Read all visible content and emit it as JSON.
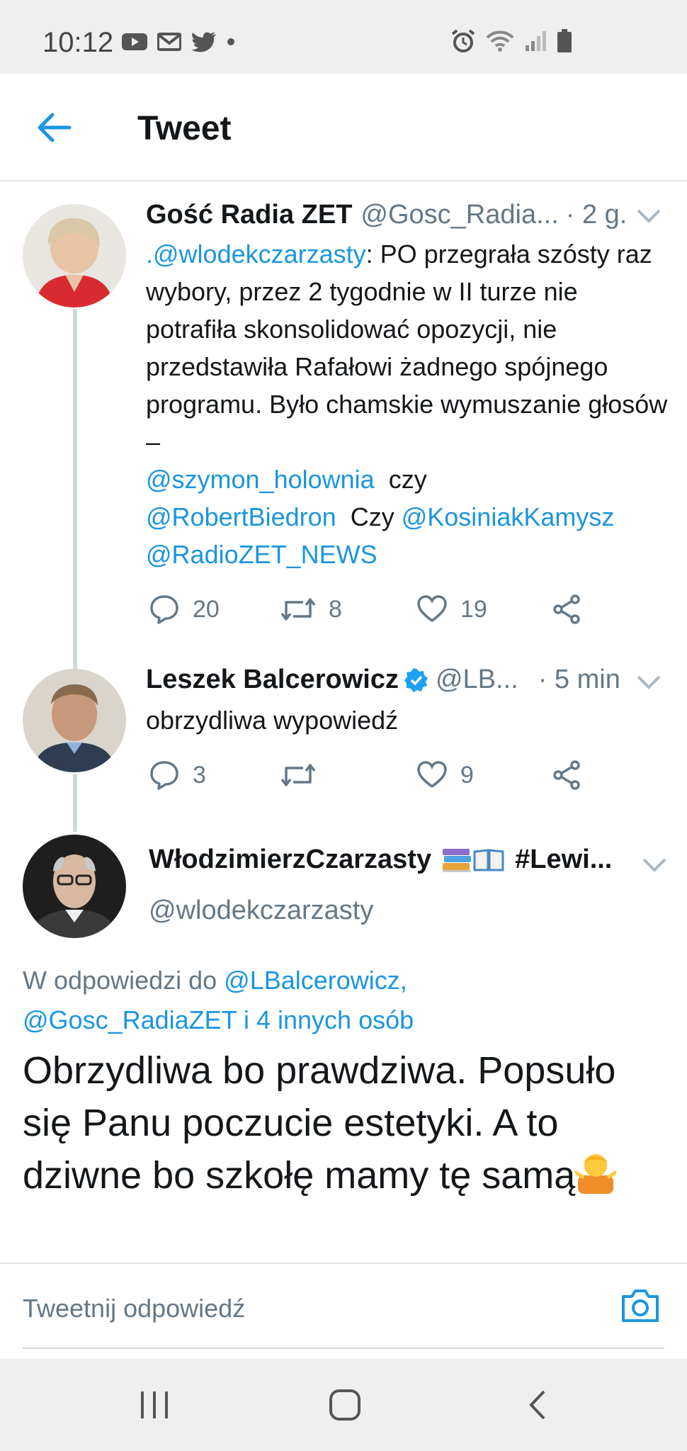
{
  "status_bar": {
    "time": "10:12",
    "left_icons": [
      "youtube-icon",
      "gmail-icon",
      "twitter-icon",
      "dot-icon"
    ],
    "right_icons": [
      "alarm-icon",
      "wifi-icon",
      "signal-icon",
      "battery-icon"
    ]
  },
  "header": {
    "title": "Tweet"
  },
  "tweets": [
    {
      "name": "Gość Radia ZET",
      "handle": "@Gosc_Radia...",
      "time": "· 2 g.",
      "text": {
        "mention1": ".@wlodekczarzasty",
        "body": ": PO przegrała szósty raz wybory, przez 2 tygodnie w II turze nie potrafiła skonsolidować opozycji, nie przedstawiła Rafałowi żadnego spójnego programu. Było chamskie wymuszanie głosów –",
        "mention2": "@szymon_holownia",
        "sep1": " czy",
        "mention3": "@RobertBiedron",
        "sep2": " Czy ",
        "mention4": "@KosiniakKamysz",
        "mention5": "@RadioZET_NEWS"
      },
      "replies": "20",
      "retweets": "8",
      "likes": "19"
    },
    {
      "name": "Leszek Balcerowicz",
      "handle": "@LB...",
      "time": "· 5 min",
      "text": "obrzydliwa wypowiedź",
      "replies": "3",
      "retweets": "",
      "likes": "9"
    }
  ],
  "main_tweet": {
    "name": "WłodzimierzCzarzasty",
    "name_suffix": "#Lewi...",
    "handle": "@wlodekczarzasty",
    "reply_prefix": "W odpowiedzi do",
    "reply_to_1": "@LBalcerowicz,",
    "reply_to_2": "@Gosc_RadiaZET i 4 innych osób",
    "text": "Obrzydliwa bo prawdziwa. Popsuło się Panu poczucie estetyki. A to dziwne bo szkołę mamy tę samą"
  },
  "reply_bar": {
    "placeholder": "Tweetnij odpowiedź"
  },
  "colors": {
    "accent": "#1b95e0",
    "text": "#14171a",
    "secondary": "#657786",
    "verified": "#1da1f2"
  }
}
